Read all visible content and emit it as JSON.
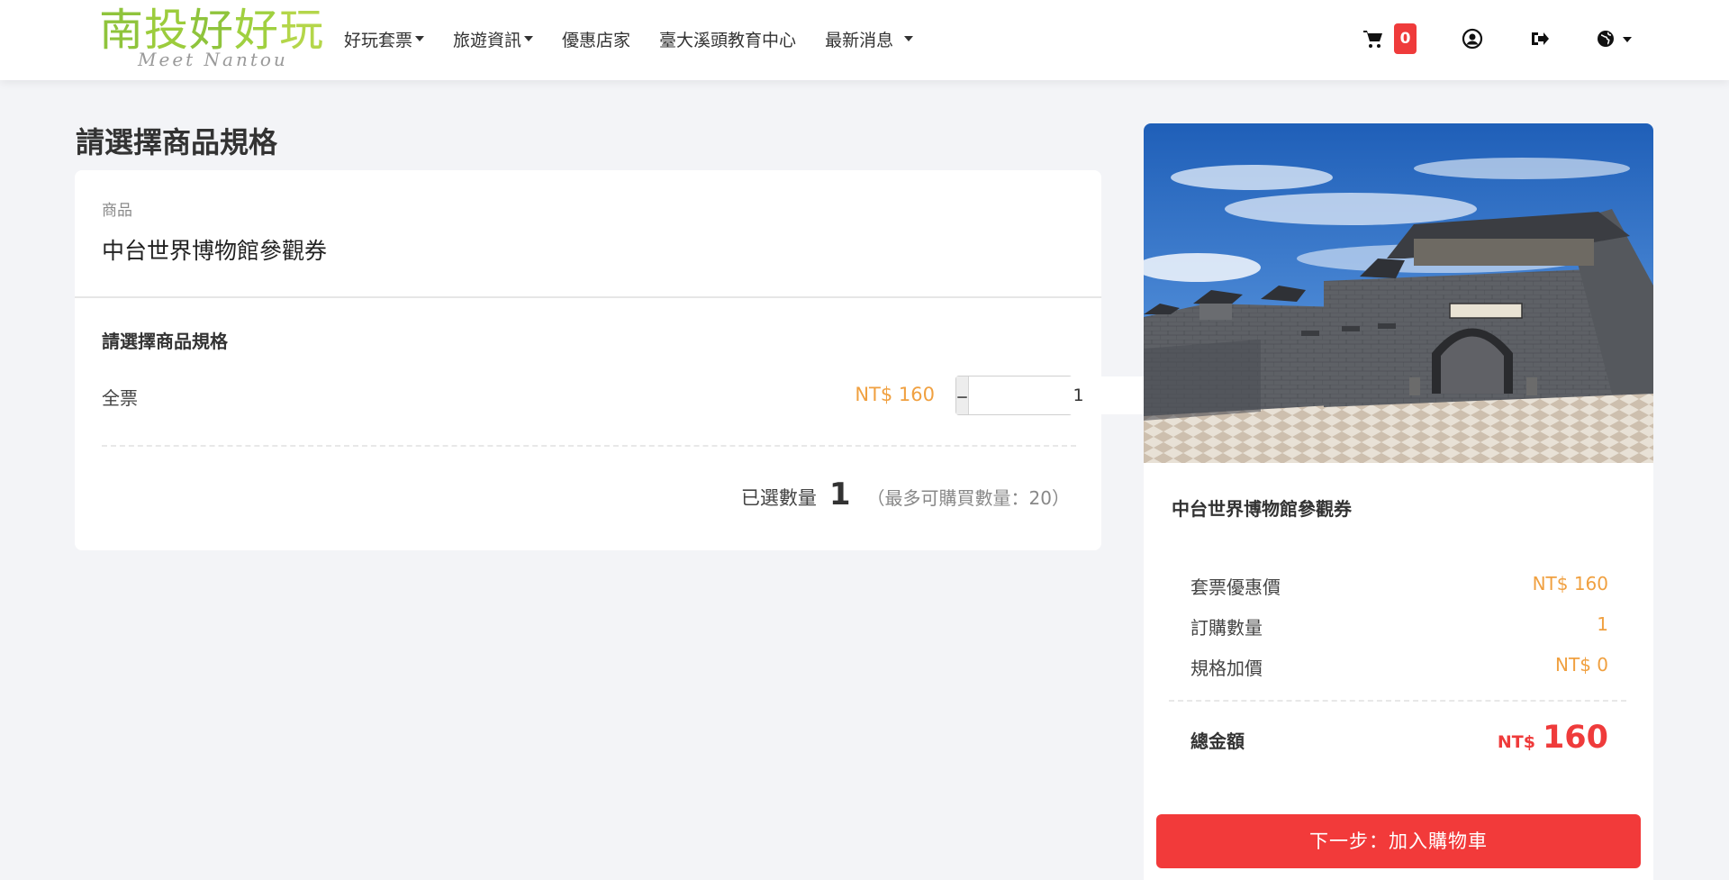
{
  "logo": {
    "chars": [
      "南",
      "投",
      "好",
      "好",
      "玩"
    ],
    "char_colors": [
      "#8fc43c",
      "#9ccc3c",
      "#8fc43c",
      "#a0d040",
      "#b4d64a"
    ],
    "tagline": "Meet Nantou"
  },
  "nav": {
    "items": [
      {
        "label": "好玩套票",
        "dropdown": true
      },
      {
        "label": "旅遊資訊",
        "dropdown": true
      },
      {
        "label": "優惠店家",
        "dropdown": false
      },
      {
        "label": "臺大溪頭教育中心",
        "dropdown": false
      },
      {
        "label": "最新消息",
        "dropdown": true
      }
    ],
    "cart_count": "0",
    "icons": [
      "cart-icon",
      "user-icon",
      "logout-icon",
      "globe-icon"
    ]
  },
  "page": {
    "title": "請選擇商品規格"
  },
  "product": {
    "label": "商品",
    "name": "中台世界博物館參觀券"
  },
  "spec": {
    "title": "請選擇商品規格",
    "name": "全票",
    "price": "NT$ 160",
    "quantity": "1",
    "minus": "–",
    "plus": "+",
    "selected_label": "已選數量",
    "selected_count": "1",
    "max_text": "（最多可購買數量：20）"
  },
  "summary": {
    "name": "中台世界博物館參觀券",
    "rows": [
      {
        "label": "套票優惠價",
        "value": "NT$ 160"
      },
      {
        "label": "訂購數量",
        "value": "1"
      },
      {
        "label": "規格加價",
        "value": "NT$ 0"
      }
    ],
    "total_label": "總金額",
    "total_currency": "NT$",
    "total_value": "160",
    "next_button": "下一步：加入購物車"
  },
  "colors": {
    "accent_red": "#f23a3a",
    "price_orange": "#f0a040",
    "logo_green": "#8fc43c"
  }
}
